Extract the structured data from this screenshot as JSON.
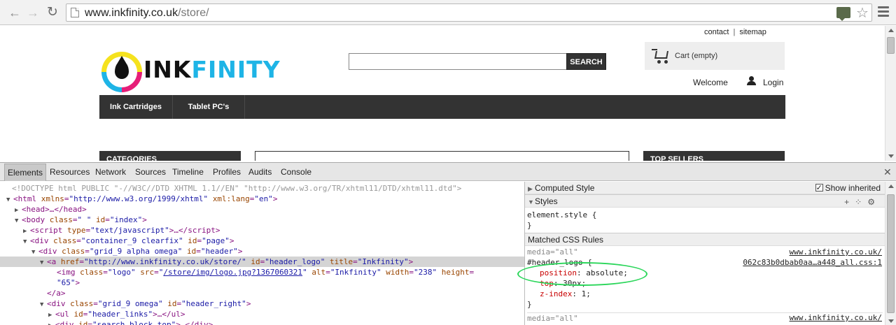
{
  "browser": {
    "url_host": "www.inkfinity.co.uk",
    "url_path": "/store/"
  },
  "site": {
    "top_links": [
      "contact",
      "sitemap"
    ],
    "logo": {
      "ink": "INK",
      "finity": "FINITY"
    },
    "search_button": "SEARCH",
    "search_value": "",
    "cart": "Cart (empty)",
    "welcome": "Welcome",
    "login": "Login",
    "nav": [
      "Ink Cartridges",
      "Tablet PC's"
    ],
    "categories_header": "CATEGORIES",
    "top_sellers_header": "TOP SELLERS"
  },
  "devtools": {
    "tabs": [
      "Elements",
      "Resources",
      "Network",
      "Sources",
      "Timeline",
      "Profiles",
      "Audits",
      "Console"
    ],
    "dom": {
      "doctype": "<!DOCTYPE html PUBLIC \"-//W3C//DTD XHTML 1.1//EN\" \"http://www.w3.org/TR/xhtml11/DTD/xhtml11.dtd\">",
      "l1_tag": "html",
      "l1_a1n": "xmlns",
      "l1_a1v": "\"http://www.w3.org/1999/xhtml\"",
      "l1_a2n": "xml:lang",
      "l1_a2v": "\"en\"",
      "l2": "<head>…</head>",
      "l3_a1v": "\" \"",
      "l3_a2v": "\"index\"",
      "l4_a1v": "\"text/javascript\"",
      "l5_a1v": "\"container_9 clearfix\"",
      "l5_a2v": "\"page\"",
      "l6_a1v": "\"grid_9 alpha omega\"",
      "l6_a2v": "\"header\"",
      "l7_href": "\"http://www.inkfinity.co.uk/store/\"",
      "l7_id": "\"header_logo\"",
      "l7_title": "\"Inkfinity\"",
      "l8_class": "\"logo\"",
      "l8_src": "/store/img/logo.jpg?1367060321",
      "l8_alt": "\"Inkfinity\"",
      "l8_width": "\"238\"",
      "l9_height": "\"65\"",
      "l11_class": "\"grid_9 omega\"",
      "l11_id": "\"header_right\"",
      "l12_id": "\"header_links\"",
      "l13_id": "\"search_block_top\""
    },
    "styles": {
      "computed_style": "Computed Style",
      "show_inherited": "Show inherited",
      "styles": "Styles",
      "element_style": "element.style {",
      "close_brace": "}",
      "matched": "Matched CSS Rules",
      "media1": "media=\"all\"",
      "source1_line1": "www.inkfinity.co.uk/",
      "selector1": "#header_logo {",
      "source1_line2": "062c83b0dbab0aa…a448_all.css:1",
      "decl1_prop": "position",
      "decl1_val": "absolute;",
      "decl2_prop": "top",
      "decl2_val": "30px;",
      "decl3_prop": "z-index",
      "decl3_val": "1;",
      "media2": "media=\"all\"",
      "source2_line1": "www.inkfinity.co.uk/"
    }
  },
  "colors": {
    "accent_logo": "#1eb4e6",
    "nav_bg": "#333333",
    "highlight": "#2bd65a"
  }
}
